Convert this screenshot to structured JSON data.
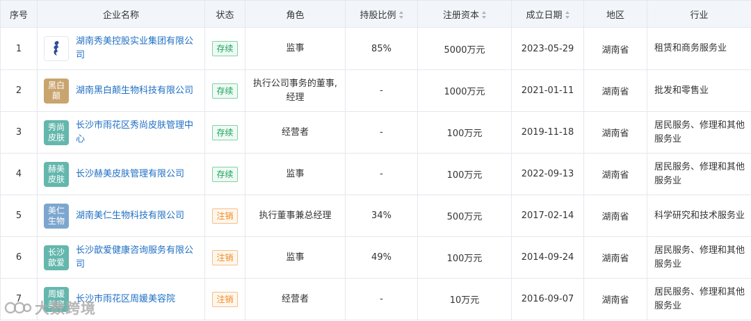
{
  "headers": {
    "index": "序号",
    "company": "企业名称",
    "status": "状态",
    "role": "角色",
    "share": "持股比例",
    "capital": "注册资本",
    "date": "成立日期",
    "region": "地区",
    "industry": "行业"
  },
  "rows": [
    {
      "index": "1",
      "logo": "",
      "logo_icon": "seahorse-logo-icon",
      "company": "湖南秀美控股实业集团有限公司",
      "status": "存续",
      "role": "监事",
      "share": "85%",
      "capital": "5000万元",
      "date": "2023-05-29",
      "region": "湖南省",
      "industry": "租赁和商务服务业"
    },
    {
      "index": "2",
      "logo": "黑白颠",
      "logo_color": "#c9a46e",
      "company": "湖南黑白颠生物科技有限公司",
      "status": "存续",
      "role": "执行公司事务的董事,经理",
      "share": "-",
      "capital": "1000万元",
      "date": "2021-01-11",
      "region": "湖南省",
      "industry": "批发和零售业"
    },
    {
      "index": "3",
      "logo": "秀尚皮肤",
      "logo_color": "#64b7ad",
      "company": "长沙市雨花区秀尚皮肤管理中心",
      "status": "存续",
      "role": "经营者",
      "share": "-",
      "capital": "100万元",
      "date": "2019-11-18",
      "region": "湖南省",
      "industry": "居民服务、修理和其他服务业"
    },
    {
      "index": "4",
      "logo": "赫美皮肤",
      "logo_color": "#64b7ad",
      "company": "长沙赫美皮肤管理有限公司",
      "status": "存续",
      "role": "监事",
      "share": "-",
      "capital": "100万元",
      "date": "2022-09-13",
      "region": "湖南省",
      "industry": "居民服务、修理和其他服务业"
    },
    {
      "index": "5",
      "logo": "美仁生物",
      "logo_color": "#7da6cf",
      "company": "湖南美仁生物科技有限公司",
      "status": "注销",
      "role": "执行董事兼总经理",
      "share": "34%",
      "capital": "500万元",
      "date": "2017-02-14",
      "region": "湖南省",
      "industry": "科学研究和技术服务业"
    },
    {
      "index": "6",
      "logo": "长沙歆爱",
      "logo_color": "#64b7ad",
      "company": "长沙歆爱健康咨询服务有限公司",
      "status": "注销",
      "role": "监事",
      "share": "49%",
      "capital": "100万元",
      "date": "2014-09-24",
      "region": "湖南省",
      "industry": "居民服务、修理和其他服务业"
    },
    {
      "index": "7",
      "logo": "周媛美容",
      "logo_color": "#64b7ad",
      "company": "长沙市雨花区周媛美容院",
      "status": "注销",
      "role": "经营者",
      "share": "-",
      "capital": "10万元",
      "date": "2016-09-07",
      "region": "湖南省",
      "industry": "居民服务、修理和其他服务业"
    }
  ],
  "status_colors": {
    "存续": "green",
    "注销": "orange"
  },
  "watermark": "大数跨境"
}
